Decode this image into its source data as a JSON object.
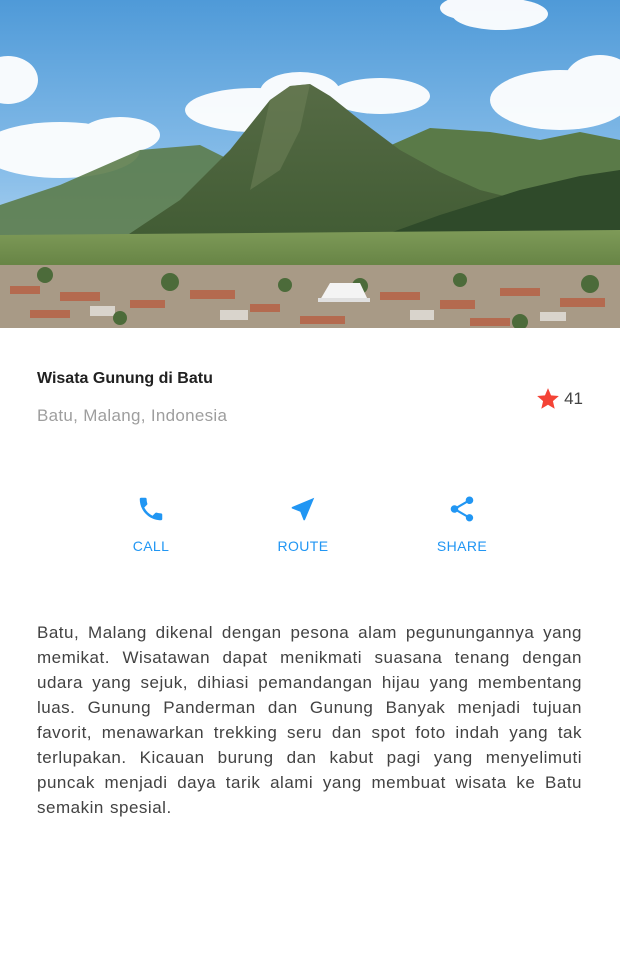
{
  "hero": {
    "image": "mountain-landscape-image"
  },
  "place": {
    "title": "Wisata Gunung di Batu",
    "location": "Batu, Malang, Indonesia",
    "rating_count": "41"
  },
  "actions": [
    {
      "label": "CALL",
      "icon": "phone-icon"
    },
    {
      "label": "ROUTE",
      "icon": "navigation-icon"
    },
    {
      "label": "SHARE",
      "icon": "share-icon"
    }
  ],
  "description": "Batu, Malang dikenal dengan pesona alam pegunungannya yang memikat. Wisatawan dapat menikmati suasana tenang dengan udara yang sejuk, dihiasi pemandangan hijau yang membentang luas. Gunung Panderman dan Gunung Banyak menjadi tujuan favorit, menawarkan trekking seru dan spot foto indah yang tak terlupakan. Kicauan burung dan kabut pagi yang menyelimuti puncak menjadi daya tarik alami yang membuat wisata ke Batu semakin spesial.",
  "colors": {
    "accent": "#2196f3",
    "star": "#f44336",
    "title": "#212121",
    "subtitle": "#9e9e9e",
    "body": "#424242"
  }
}
